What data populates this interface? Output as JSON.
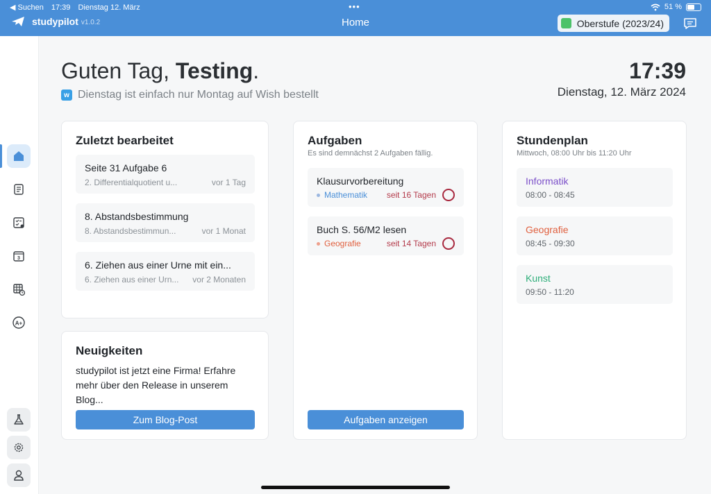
{
  "status_bar": {
    "back": "◀ Suchen",
    "time": "17:39",
    "date": "Dienstag 12. März",
    "dots": "•••",
    "wifi": "wifi-icon",
    "battery": "51 %"
  },
  "app": {
    "name": "studypilot",
    "version": "v1.0.2",
    "nav_title": "Home",
    "term": "Oberstufe (2023/24)",
    "accent": "#4a8fd8"
  },
  "sidebar": {
    "items": [
      {
        "icon": "home-icon",
        "active": true
      },
      {
        "icon": "notebook-icon"
      },
      {
        "icon": "task-list-icon"
      },
      {
        "icon": "calendar-icon",
        "glyph": "3"
      },
      {
        "icon": "timetable-icon"
      },
      {
        "icon": "grade-icon",
        "glyph": "A+"
      }
    ],
    "bottom": [
      {
        "icon": "flask-icon"
      },
      {
        "icon": "gear-icon"
      },
      {
        "icon": "user-icon"
      }
    ]
  },
  "header": {
    "greeting_prefix": "Guten Tag, ",
    "user_name": "Testing",
    "greeting_suffix": ".",
    "motto": "Dienstag ist einfach nur Montag auf Wish bestellt",
    "clock": "17:39",
    "date": "Dienstag, 12. März 2024"
  },
  "recent": {
    "title": "Zuletzt bearbeitet",
    "items": [
      {
        "title": "Seite 31 Aufgabe 6",
        "sub": "2. Differentialquotient u...",
        "meta": "vor 1 Tag"
      },
      {
        "title": "8. Abstandsbestimmung",
        "sub": "8. Abstandsbestimmun...",
        "meta": "vor 1 Monat"
      },
      {
        "title": "6. Ziehen aus einer Urne mit ein...",
        "sub": "6. Ziehen aus einer Urn...",
        "meta": "vor 2 Monaten"
      }
    ]
  },
  "news": {
    "title": "Neuigkeiten",
    "text": "studypilot ist jetzt eine Firma! Erfahre mehr über den Release in unserem Blog...",
    "button": "Zum Blog-Post"
  },
  "tasks": {
    "title": "Aufgaben",
    "subtitle": "Es sind demnächst 2 Aufgaben fällig.",
    "items": [
      {
        "title": "Klausurvorbereitung",
        "subject": "Mathematik",
        "subject_color": "#4a8fd8",
        "due": "seit 16 Tagen"
      },
      {
        "title": "Buch S. 56/M2 lesen",
        "subject": "Geografie",
        "subject_color": "#e0603f",
        "due": "seit 14 Tagen"
      }
    ],
    "button": "Aufgaben anzeigen"
  },
  "schedule": {
    "title": "Stundenplan",
    "subtitle": "Mittwoch, 08:00 Uhr bis 11:20 Uhr",
    "lessons": [
      {
        "name": "Informatik",
        "time": "08:00 - 08:45",
        "color": "#7b4fc9"
      },
      {
        "name": "Geografie",
        "time": "08:45 - 09:30",
        "color": "#e0603f"
      },
      {
        "name": "Kunst",
        "time": "09:50 - 11:20",
        "color": "#2fae7a"
      }
    ]
  }
}
